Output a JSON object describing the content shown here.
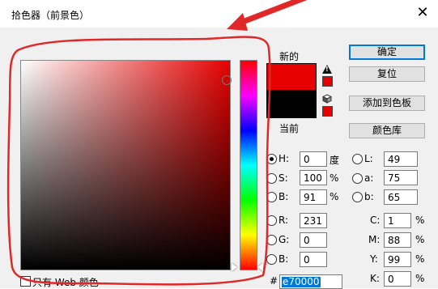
{
  "window": {
    "title": "拾色器（前景色）",
    "close_glyph": "✕"
  },
  "swatch": {
    "new_label": "新的",
    "current_label": "当前",
    "new_color": "#e70000",
    "current_color": "#000000"
  },
  "buttons": {
    "ok": "确定",
    "reset": "复位",
    "add_to_swatches": "添加到色板",
    "color_libraries": "颜色库"
  },
  "hsb": {
    "h": {
      "label": "H:",
      "value": "0",
      "unit": "度"
    },
    "s": {
      "label": "S:",
      "value": "100",
      "unit": "%"
    },
    "b": {
      "label": "B:",
      "value": "91",
      "unit": "%"
    }
  },
  "lab": {
    "l": {
      "label": "L:",
      "value": "49"
    },
    "a": {
      "label": "a:",
      "value": "75"
    },
    "b": {
      "label": "b:",
      "value": "65"
    }
  },
  "rgb": {
    "r": {
      "label": "R:",
      "value": "231"
    },
    "g": {
      "label": "G:",
      "value": "0"
    },
    "b": {
      "label": "B:",
      "value": "0"
    }
  },
  "cmyk": {
    "c": {
      "label": "C:",
      "value": "1",
      "unit": "%"
    },
    "m": {
      "label": "M:",
      "value": "88",
      "unit": "%"
    },
    "y": {
      "label": "Y:",
      "value": "99",
      "unit": "%"
    },
    "k": {
      "label": "K:",
      "value": "0",
      "unit": "%"
    }
  },
  "hex": {
    "label": "#",
    "value": "e70000"
  },
  "web_only": {
    "label": "只有 Web 颜色"
  },
  "colors": {
    "annotation": "#e02828",
    "accent": "#0078d7"
  }
}
